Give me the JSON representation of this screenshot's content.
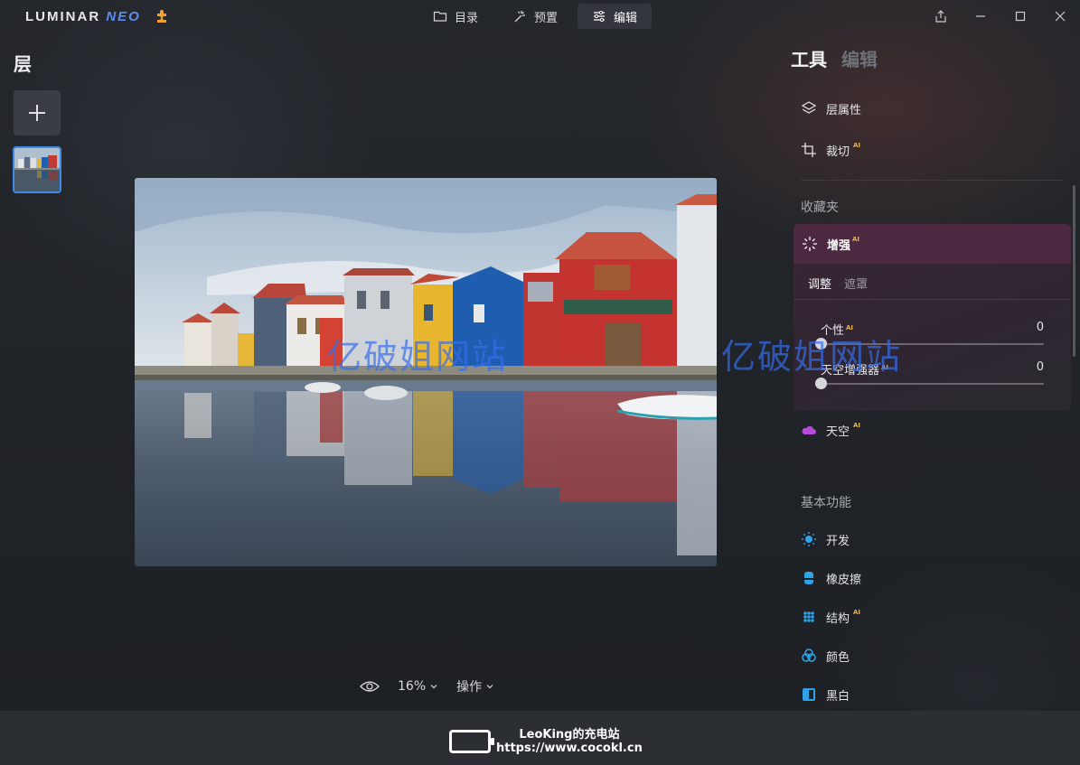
{
  "app": {
    "logo_main": "LUMINAR",
    "logo_neo": "NEO"
  },
  "nav": {
    "tabs": [
      {
        "label": "目录",
        "icon": "folder-icon"
      },
      {
        "label": "预置",
        "icon": "magic-wand-icon"
      },
      {
        "label": "编辑",
        "icon": "sliders-icon",
        "active": true
      }
    ]
  },
  "layers": {
    "title": "层"
  },
  "view": {
    "zoom": "16%",
    "actions": "操作"
  },
  "tools": {
    "tab_tools": "工具",
    "tab_edit": "编辑",
    "layer_props": "层属性",
    "crop": "裁切",
    "favorites_label": "收藏夹",
    "enhance": "增强",
    "subtab_adjust": "调整",
    "subtab_mask": "遮罩",
    "sliders": [
      {
        "label": "个性",
        "value": "0",
        "position": 0
      },
      {
        "label": "天空增强器",
        "value": "0",
        "position": 0
      }
    ],
    "sky": "天空",
    "basics_label": "基本功能",
    "develop": "开发",
    "eraser": "橡皮擦",
    "structure": "结构",
    "color": "颜色",
    "bw": "黑白",
    "ai": "AI"
  },
  "watermark": {
    "left": "亿破姐网站",
    "right": "亿破姐网站"
  },
  "footer": {
    "line1": "LeoKing的充电站",
    "line2": "https://www.cocokl.cn"
  },
  "colors": {
    "accent_blue": "#3d8ce8",
    "ai_badge": "#e8b453",
    "enhance_header": "#4c2841"
  }
}
